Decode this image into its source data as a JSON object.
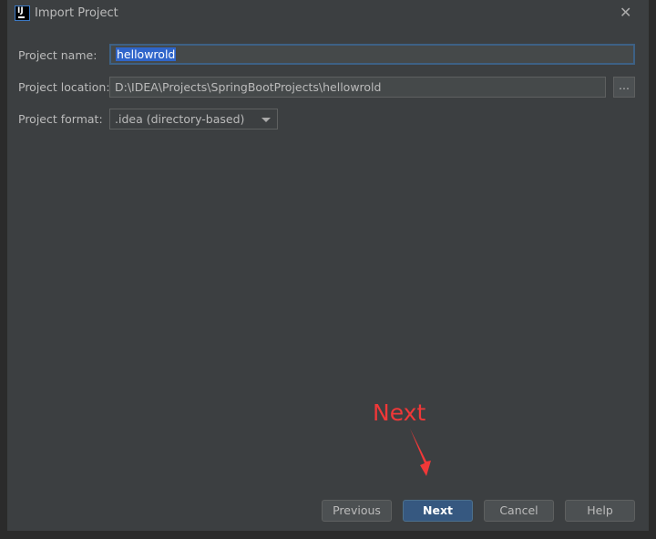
{
  "dialog": {
    "title": "Import Project",
    "logo": "IJ"
  },
  "form": {
    "name_label": "Project name:",
    "name_value": "hellowrold",
    "location_label": "Project location:",
    "location_value": "D:\\IDEA\\Projects\\SpringBootProjects\\hellowrold",
    "browse_label": "...",
    "format_label": "Project format:",
    "format_value": ".idea (directory-based)"
  },
  "buttons": {
    "previous": "Previous",
    "next": "Next",
    "cancel": "Cancel",
    "help": "Help"
  },
  "annotation": {
    "text": "Next",
    "color": "#f03838"
  },
  "colors": {
    "accent": "#365880",
    "selection": "#2f65ca",
    "background": "#3c3f41"
  }
}
